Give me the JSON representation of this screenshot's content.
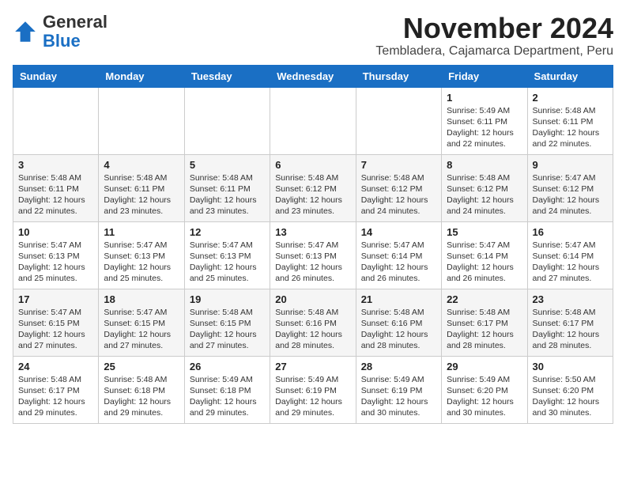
{
  "logo": {
    "general": "General",
    "blue": "Blue"
  },
  "title": "November 2024",
  "location": "Tembladera, Cajamarca Department, Peru",
  "days_of_week": [
    "Sunday",
    "Monday",
    "Tuesday",
    "Wednesday",
    "Thursday",
    "Friday",
    "Saturday"
  ],
  "weeks": [
    [
      {
        "day": "",
        "info": ""
      },
      {
        "day": "",
        "info": ""
      },
      {
        "day": "",
        "info": ""
      },
      {
        "day": "",
        "info": ""
      },
      {
        "day": "",
        "info": ""
      },
      {
        "day": "1",
        "info": "Sunrise: 5:49 AM\nSunset: 6:11 PM\nDaylight: 12 hours and 22 minutes."
      },
      {
        "day": "2",
        "info": "Sunrise: 5:48 AM\nSunset: 6:11 PM\nDaylight: 12 hours and 22 minutes."
      }
    ],
    [
      {
        "day": "3",
        "info": "Sunrise: 5:48 AM\nSunset: 6:11 PM\nDaylight: 12 hours and 22 minutes."
      },
      {
        "day": "4",
        "info": "Sunrise: 5:48 AM\nSunset: 6:11 PM\nDaylight: 12 hours and 23 minutes."
      },
      {
        "day": "5",
        "info": "Sunrise: 5:48 AM\nSunset: 6:11 PM\nDaylight: 12 hours and 23 minutes."
      },
      {
        "day": "6",
        "info": "Sunrise: 5:48 AM\nSunset: 6:12 PM\nDaylight: 12 hours and 23 minutes."
      },
      {
        "day": "7",
        "info": "Sunrise: 5:48 AM\nSunset: 6:12 PM\nDaylight: 12 hours and 24 minutes."
      },
      {
        "day": "8",
        "info": "Sunrise: 5:48 AM\nSunset: 6:12 PM\nDaylight: 12 hours and 24 minutes."
      },
      {
        "day": "9",
        "info": "Sunrise: 5:47 AM\nSunset: 6:12 PM\nDaylight: 12 hours and 24 minutes."
      }
    ],
    [
      {
        "day": "10",
        "info": "Sunrise: 5:47 AM\nSunset: 6:13 PM\nDaylight: 12 hours and 25 minutes."
      },
      {
        "day": "11",
        "info": "Sunrise: 5:47 AM\nSunset: 6:13 PM\nDaylight: 12 hours and 25 minutes."
      },
      {
        "day": "12",
        "info": "Sunrise: 5:47 AM\nSunset: 6:13 PM\nDaylight: 12 hours and 25 minutes."
      },
      {
        "day": "13",
        "info": "Sunrise: 5:47 AM\nSunset: 6:13 PM\nDaylight: 12 hours and 26 minutes."
      },
      {
        "day": "14",
        "info": "Sunrise: 5:47 AM\nSunset: 6:14 PM\nDaylight: 12 hours and 26 minutes."
      },
      {
        "day": "15",
        "info": "Sunrise: 5:47 AM\nSunset: 6:14 PM\nDaylight: 12 hours and 26 minutes."
      },
      {
        "day": "16",
        "info": "Sunrise: 5:47 AM\nSunset: 6:14 PM\nDaylight: 12 hours and 27 minutes."
      }
    ],
    [
      {
        "day": "17",
        "info": "Sunrise: 5:47 AM\nSunset: 6:15 PM\nDaylight: 12 hours and 27 minutes."
      },
      {
        "day": "18",
        "info": "Sunrise: 5:47 AM\nSunset: 6:15 PM\nDaylight: 12 hours and 27 minutes."
      },
      {
        "day": "19",
        "info": "Sunrise: 5:48 AM\nSunset: 6:15 PM\nDaylight: 12 hours and 27 minutes."
      },
      {
        "day": "20",
        "info": "Sunrise: 5:48 AM\nSunset: 6:16 PM\nDaylight: 12 hours and 28 minutes."
      },
      {
        "day": "21",
        "info": "Sunrise: 5:48 AM\nSunset: 6:16 PM\nDaylight: 12 hours and 28 minutes."
      },
      {
        "day": "22",
        "info": "Sunrise: 5:48 AM\nSunset: 6:17 PM\nDaylight: 12 hours and 28 minutes."
      },
      {
        "day": "23",
        "info": "Sunrise: 5:48 AM\nSunset: 6:17 PM\nDaylight: 12 hours and 28 minutes."
      }
    ],
    [
      {
        "day": "24",
        "info": "Sunrise: 5:48 AM\nSunset: 6:17 PM\nDaylight: 12 hours and 29 minutes."
      },
      {
        "day": "25",
        "info": "Sunrise: 5:48 AM\nSunset: 6:18 PM\nDaylight: 12 hours and 29 minutes."
      },
      {
        "day": "26",
        "info": "Sunrise: 5:49 AM\nSunset: 6:18 PM\nDaylight: 12 hours and 29 minutes."
      },
      {
        "day": "27",
        "info": "Sunrise: 5:49 AM\nSunset: 6:19 PM\nDaylight: 12 hours and 29 minutes."
      },
      {
        "day": "28",
        "info": "Sunrise: 5:49 AM\nSunset: 6:19 PM\nDaylight: 12 hours and 30 minutes."
      },
      {
        "day": "29",
        "info": "Sunrise: 5:49 AM\nSunset: 6:20 PM\nDaylight: 12 hours and 30 minutes."
      },
      {
        "day": "30",
        "info": "Sunrise: 5:50 AM\nSunset: 6:20 PM\nDaylight: 12 hours and 30 minutes."
      }
    ]
  ]
}
